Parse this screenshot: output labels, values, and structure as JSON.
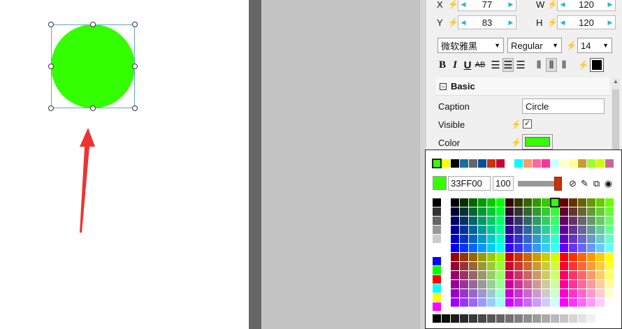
{
  "shape": {
    "fill": "#33FF00",
    "selection_color": "#5fa8c8"
  },
  "position": {
    "x_label": "X",
    "x_value": "77",
    "y_label": "Y",
    "y_value": "83",
    "w_label": "W",
    "w_value": "120",
    "h_label": "H",
    "h_value": "120"
  },
  "font": {
    "family": "微软雅黑",
    "style": "Regular",
    "size": "14"
  },
  "format_toolbar": {
    "bold": "B",
    "italic": "I",
    "underline": "U",
    "strike": "AB"
  },
  "basic_section": {
    "title": "Basic",
    "caption_label": "Caption",
    "caption_value": "Circle",
    "visible_label": "Visible",
    "visible_checked": true,
    "color_label": "Color",
    "color_value": "#33FF00"
  },
  "color_picker": {
    "hex": "33FF00",
    "alpha": "100",
    "current": "#33FF00",
    "recent": [
      "#33FF00",
      "#FFFF00",
      "#000000",
      "#1a6fa0",
      "#666666",
      "#0050a0",
      "#cc3300",
      "#cc0033",
      "#ffffff",
      "#00ffff",
      "#ff9966",
      "#ff6699",
      "#ff3399",
      "#ccffff",
      "#ffffcc",
      "#ffff99",
      "#cc9933",
      "#99ff33",
      "#ccff00",
      "#cc6699"
    ],
    "gray_column": [
      "#000000",
      "#333333",
      "#666666",
      "#999999",
      "#cccccc",
      "#ffffff",
      "#0000ff",
      "#00ff00",
      "#ff0000",
      "#00ffff",
      "#ffff00",
      "#ff00ff"
    ]
  },
  "annotation": {
    "arrow_color": "#ee3333"
  }
}
